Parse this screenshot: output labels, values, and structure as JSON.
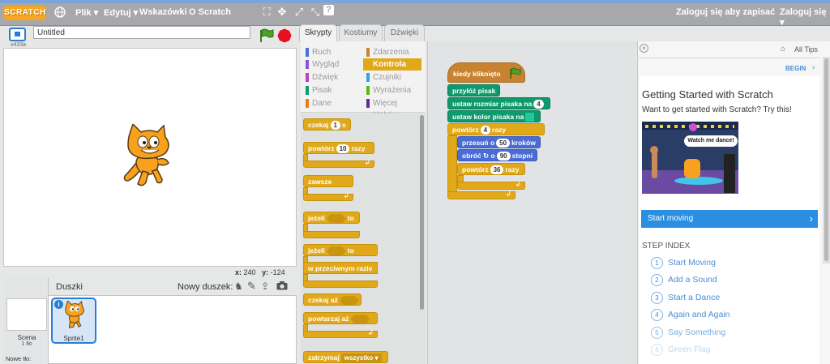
{
  "menubar": {
    "logo_text": "SCRATCH",
    "items": [
      "Plik ▾",
      "Edytuj ▾",
      "Wskazówki",
      "O Scratch"
    ],
    "right": [
      "Zaloguj się aby zapisać",
      "Zaloguj się ▾"
    ]
  },
  "stage": {
    "title_value": "Untitled",
    "version": "v433a",
    "coords_x_label": "x:",
    "coords_x": "240",
    "coords_y_label": "y:",
    "coords_y": "-124"
  },
  "sprites": {
    "header": "Duszki",
    "new_sprite_label": "Nowy duszek:",
    "stage_label": "Scena",
    "stage_sub": "1 tło",
    "new_backdrop": "Nowe tło:",
    "sprite_name": "Sprite1",
    "info": "i"
  },
  "tabs": [
    "Skrypty",
    "Kostiumy",
    "Dźwięki"
  ],
  "categories": [
    {
      "label": "Ruch",
      "color": "#4a6cd4"
    },
    {
      "label": "Zdarzenia",
      "color": "#c88330"
    },
    {
      "label": "Wygląd",
      "color": "#8a55d7"
    },
    {
      "label": "Kontrola",
      "color": "#e1a91a"
    },
    {
      "label": "Dźwięk",
      "color": "#bb42c3"
    },
    {
      "label": "Czujniki",
      "color": "#2ca5e2"
    },
    {
      "label": "Pisak",
      "color": "#0e9a6c"
    },
    {
      "label": "Wyrażenia",
      "color": "#5cb712"
    },
    {
      "label": "Dane",
      "color": "#ee7d16"
    },
    {
      "label": "Więcej bloków",
      "color": "#632d99"
    }
  ],
  "palette_blocks": {
    "wait": "czekaj",
    "wait_val": "1",
    "wait_unit": "s",
    "repeat": "powtórz",
    "repeat_val": "10",
    "repeat_unit": "razy",
    "forever": "zawsze",
    "if": "jeżeli",
    "then": "to",
    "if2": "jeżeli",
    "then2": "to",
    "else": "w przeciwnym razie",
    "wait_until": "czekaj aż",
    "repeat_until": "powtarzaj aż",
    "stop": "zatrzymaj",
    "stop_val": "wszystko ▾"
  },
  "script": {
    "hat": "kiedy kliknięto",
    "pen_down": "przyłóż pisak",
    "set_size": "ustaw rozmiar pisaka na",
    "set_size_val": "4",
    "set_color": "ustaw kolor pisaka na",
    "repeat": "powtórz",
    "repeat_val": "4",
    "repeat_unit": "razy",
    "move": "przesuń o",
    "move_val": "50",
    "move_unit": "kroków",
    "turn": "obróć",
    "turn_o": "o",
    "turn_val": "90",
    "turn_unit": "stopni",
    "inner_repeat": "powtórz",
    "inner_repeat_val": "36",
    "inner_repeat_unit": "razy"
  },
  "tips": {
    "all_tips": "All Tips",
    "begin": "BEGIN",
    "title": "Getting Started with Scratch",
    "subtitle": "Want to get started with Scratch? Try this!",
    "speech": "Watch me dance!",
    "start_button": "Start moving",
    "step_index": "STEP INDEX",
    "steps": [
      "Start Moving",
      "Add a Sound",
      "Start a Dance",
      "Again and Again",
      "Say Something",
      "Green Flag"
    ]
  }
}
